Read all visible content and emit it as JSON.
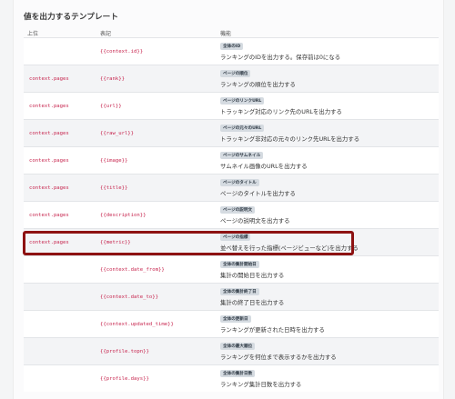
{
  "section": {
    "title": "値を出力するテンプレート"
  },
  "table": {
    "headers": {
      "parent": "上位",
      "notation": "表記",
      "function": "機能"
    },
    "rows": [
      {
        "parent": "",
        "notation": "{{context.id}}",
        "badge": "全体のID",
        "desc": "ランキングのIDを出力する。保存前は0になる"
      },
      {
        "parent": "context.pages",
        "notation": "{{rank}}",
        "badge": "ページの順位",
        "desc": "ランキングの順位を出力する"
      },
      {
        "parent": "context.pages",
        "notation": "{{url}}",
        "badge": "ページのリンクURL",
        "desc": "トラッキング対応のリンク先のURLを出力する"
      },
      {
        "parent": "context.pages",
        "notation": "{{raw_url}}",
        "badge": "ページの元々のURL",
        "desc": "トラッキング非対応の元々のリンク先URLを出力する"
      },
      {
        "parent": "context.pages",
        "notation": "{{image}}",
        "badge": "ページのサムネイル",
        "desc": "サムネイル画像のURLを出力する"
      },
      {
        "parent": "context.pages",
        "notation": "{{title}}",
        "badge": "ページのタイトル",
        "desc": "ページのタイトルを出力する"
      },
      {
        "parent": "context.pages",
        "notation": "{{description}}",
        "badge": "ページの説明文",
        "desc": "ページの説明文を出力する"
      },
      {
        "parent": "context.pages",
        "notation": "{{metric}}",
        "badge": "ページの指標",
        "desc": "並べ替えを行った指標(ページビューなど)を出力する"
      },
      {
        "parent": "",
        "notation": "{{context.date_from}}",
        "badge": "全体の集計開始日",
        "desc": "集計の開始日を出力する"
      },
      {
        "parent": "",
        "notation": "{{context.date_to}}",
        "badge": "全体の集計終了日",
        "desc": "集計の終了日を出力する"
      },
      {
        "parent": "",
        "notation": "{{context.updated_time}}",
        "badge": "全体の更新日",
        "desc": "ランキングが更新された日時を出力する"
      },
      {
        "parent": "",
        "notation": "{{profile.topn}}",
        "badge": "全体の最大順位",
        "desc": "ランキングを何位まで表示するかを出力する"
      },
      {
        "parent": "",
        "notation": "{{profile.days}}",
        "badge": "全体の集計日数",
        "desc": "ランキング集計日数を出力する"
      }
    ]
  },
  "colors": {
    "code": "#c7254e",
    "highlight": "#8d1212",
    "badge_bg": "#d5dbe1"
  }
}
